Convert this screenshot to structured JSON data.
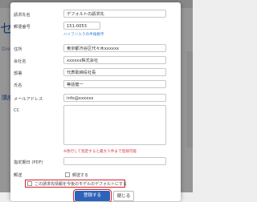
{
  "background": {
    "title": "セミ",
    "subtext": "Dreamweaver",
    "link": "講座"
  },
  "form": {
    "name_label": "請求先名",
    "name_value": "デフォルトの請求先",
    "zip_label": "郵便番号",
    "zip_value": "151-0053",
    "zip_note": "ハイフン入りの半角数字",
    "address_label": "住所",
    "address_value": "東京都渋谷区代々木xxxxxx",
    "company_label": "会社名",
    "company_value": "xxxxxx株式会社",
    "dept_label": "部署",
    "dept_value": "代表取締役社長",
    "person_label": "氏名",
    "person_value": "等話健一",
    "email_label": "メールアドレス",
    "email_value": "info@xxxxxx",
    "cc_label": "CC",
    "cc_note": "※改行して指定すると最大５件まで登録可能",
    "invoice_label": "指定期日 (PDF)",
    "invoice_value": "",
    "postal_label": "郵送",
    "postal_check_label": "郵送する",
    "default_check_label": "この請求先情報を今後のモデルのデフォルトにする",
    "submit_label": "登録する",
    "cancel_label": "閉じる"
  },
  "colors": {
    "primary": "#2d63b8",
    "highlight": "#d8232a",
    "link": "#2e7bd9",
    "warning": "#d8333d"
  }
}
